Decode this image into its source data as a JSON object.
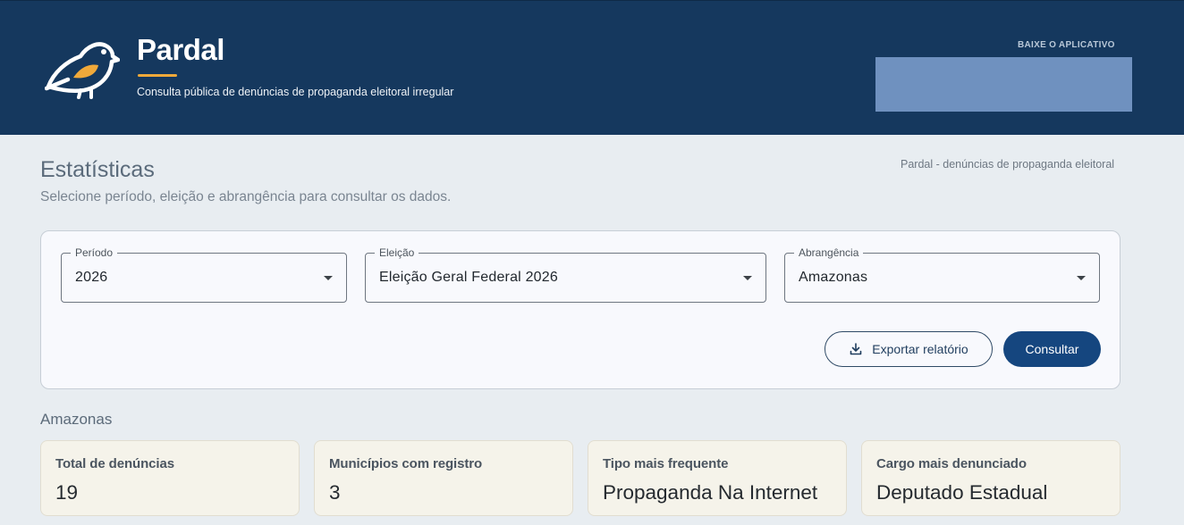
{
  "header": {
    "title": "Pardal",
    "subtitle": "Consulta pública de denúncias de propaganda eleitoral irregular",
    "app_label": "BAIXE O APLICATIVO",
    "accent_color": "#f0a93a",
    "background_color": "#15385e"
  },
  "page": {
    "title": "Estatísticas",
    "subtitle": "Selecione período, eleição e abrangência para consultar os dados.",
    "breadcrumb": "Pardal - denúncias de propaganda eleitoral"
  },
  "filters": {
    "periodo": {
      "label": "Período",
      "value": "2026"
    },
    "eleicao": {
      "label": "Eleição",
      "value": "Eleição Geral Federal 2026"
    },
    "abrangencia": {
      "label": "Abrangência",
      "value": "Amazonas"
    },
    "export_label": "Exportar relatório",
    "consult_label": "Consultar",
    "primary_color": "#15467f"
  },
  "results": {
    "section_title": "Amazonas",
    "stats": [
      {
        "label": "Total de denúncias",
        "value": "19"
      },
      {
        "label": "Municípios com registro",
        "value": "3"
      },
      {
        "label": "Tipo mais frequente",
        "value": "Propaganda Na Internet"
      },
      {
        "label": "Cargo mais denunciado",
        "value": "Deputado Estadual"
      }
    ]
  },
  "icons": {
    "logo": "sparrow-logo-icon",
    "dropdown": "chevron-down-icon",
    "export": "download-icon"
  }
}
